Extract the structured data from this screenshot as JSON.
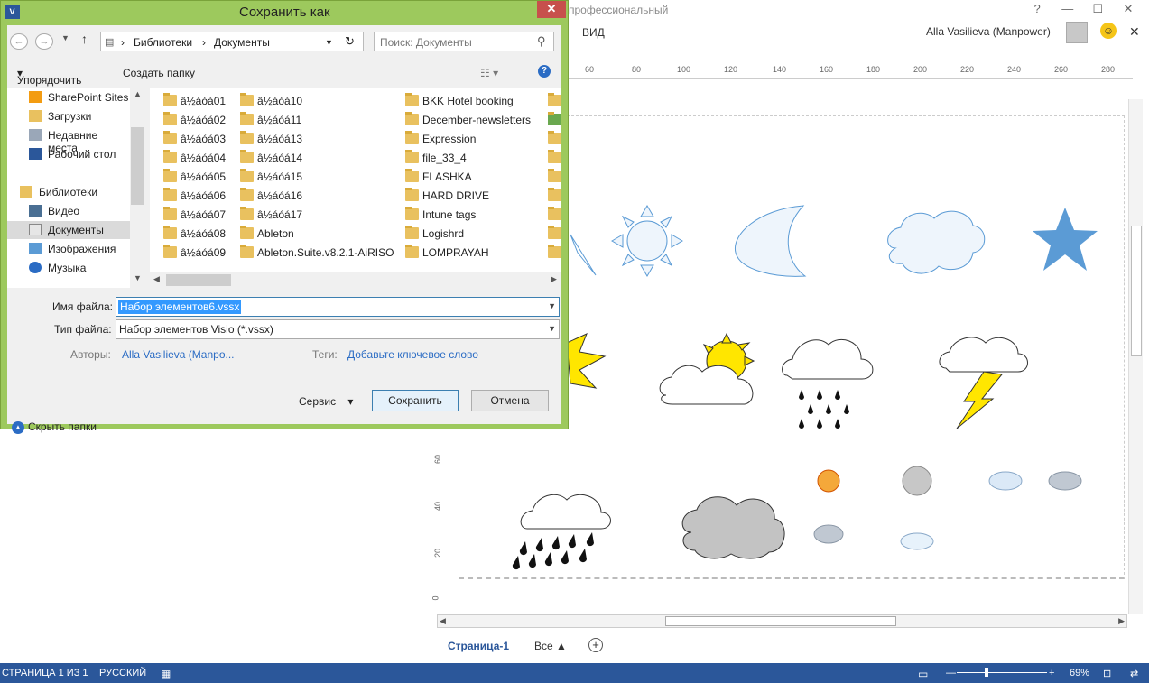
{
  "visio": {
    "title": "профессиональный",
    "ribbon_tab": "ВИД",
    "user": "Alla Vasilieva (Manpower)",
    "window_controls": [
      "?",
      "—",
      "☐",
      "✕"
    ],
    "ruler_h": [
      "60",
      "80",
      "100",
      "120",
      "140",
      "160",
      "180",
      "200",
      "220",
      "240",
      "260",
      "280"
    ],
    "ruler_v": [
      "60",
      "40",
      "20",
      "0"
    ],
    "page_tab": "Страница-1",
    "all_tab": "Все",
    "status": {
      "page": "СТРАНИЦА 1 ИЗ 1",
      "lang": "РУССКИЙ",
      "zoom": "69%"
    }
  },
  "dialog": {
    "title": "Сохранить как",
    "breadcrumb": [
      "Библиотеки",
      "Документы"
    ],
    "search_placeholder": "Поиск: Документы",
    "toolbar": {
      "organize": "Упорядочить",
      "new_folder": "Создать папку"
    },
    "nav_items": [
      {
        "label": "SharePoint Sites",
        "icon": "sharepoint-icon"
      },
      {
        "label": "Загрузки",
        "icon": "downloads-icon"
      },
      {
        "label": "Недавние места",
        "icon": "recent-places-icon"
      },
      {
        "label": "Рабочий стол",
        "icon": "desktop-icon"
      },
      {
        "label": "Библиотеки",
        "icon": "libraries-icon"
      },
      {
        "label": "Видео",
        "icon": "video-icon"
      },
      {
        "label": "Документы",
        "icon": "documents-icon"
      },
      {
        "label": "Изображения",
        "icon": "pictures-icon"
      },
      {
        "label": "Музыка",
        "icon": "music-icon"
      }
    ],
    "files_col1": [
      "â½áóá01",
      "â½áóá02",
      "â½áóá03",
      "â½áóá04",
      "â½áóá05",
      "â½áóá06",
      "â½áóá07",
      "â½áóá08",
      "â½áóá09"
    ],
    "files_col2": [
      "â½áóá10",
      "â½áóá11",
      "â½áóá13",
      "â½áóá14",
      "â½áóá15",
      "â½áóá16",
      "â½áóá17",
      "Ableton",
      "Ableton.Suite.v8.2.1-AiRISO"
    ],
    "files_col3": [
      "BKK Hotel booking",
      "December-newsletters",
      "Expression",
      "file_33_4",
      "FLASHKA",
      "HARD DRIVE",
      "Intune tags",
      "Logishrd",
      "LOMPRAYAH"
    ],
    "form": {
      "filename_label": "Имя файла:",
      "filename_value": "Набор элементов6.vssx",
      "filetype_label": "Тип файла:",
      "filetype_value": "Набор элементов Visio (*.vssx)",
      "authors_label": "Авторы:",
      "authors_value": "Alla Vasilieva (Manpo...",
      "tags_label": "Теги:",
      "tags_value": "Добавьте ключевое слово"
    },
    "buttons": {
      "service": "Сервис",
      "save": "Сохранить",
      "cancel": "Отмена",
      "hide_folders": "Скрыть папки"
    }
  }
}
